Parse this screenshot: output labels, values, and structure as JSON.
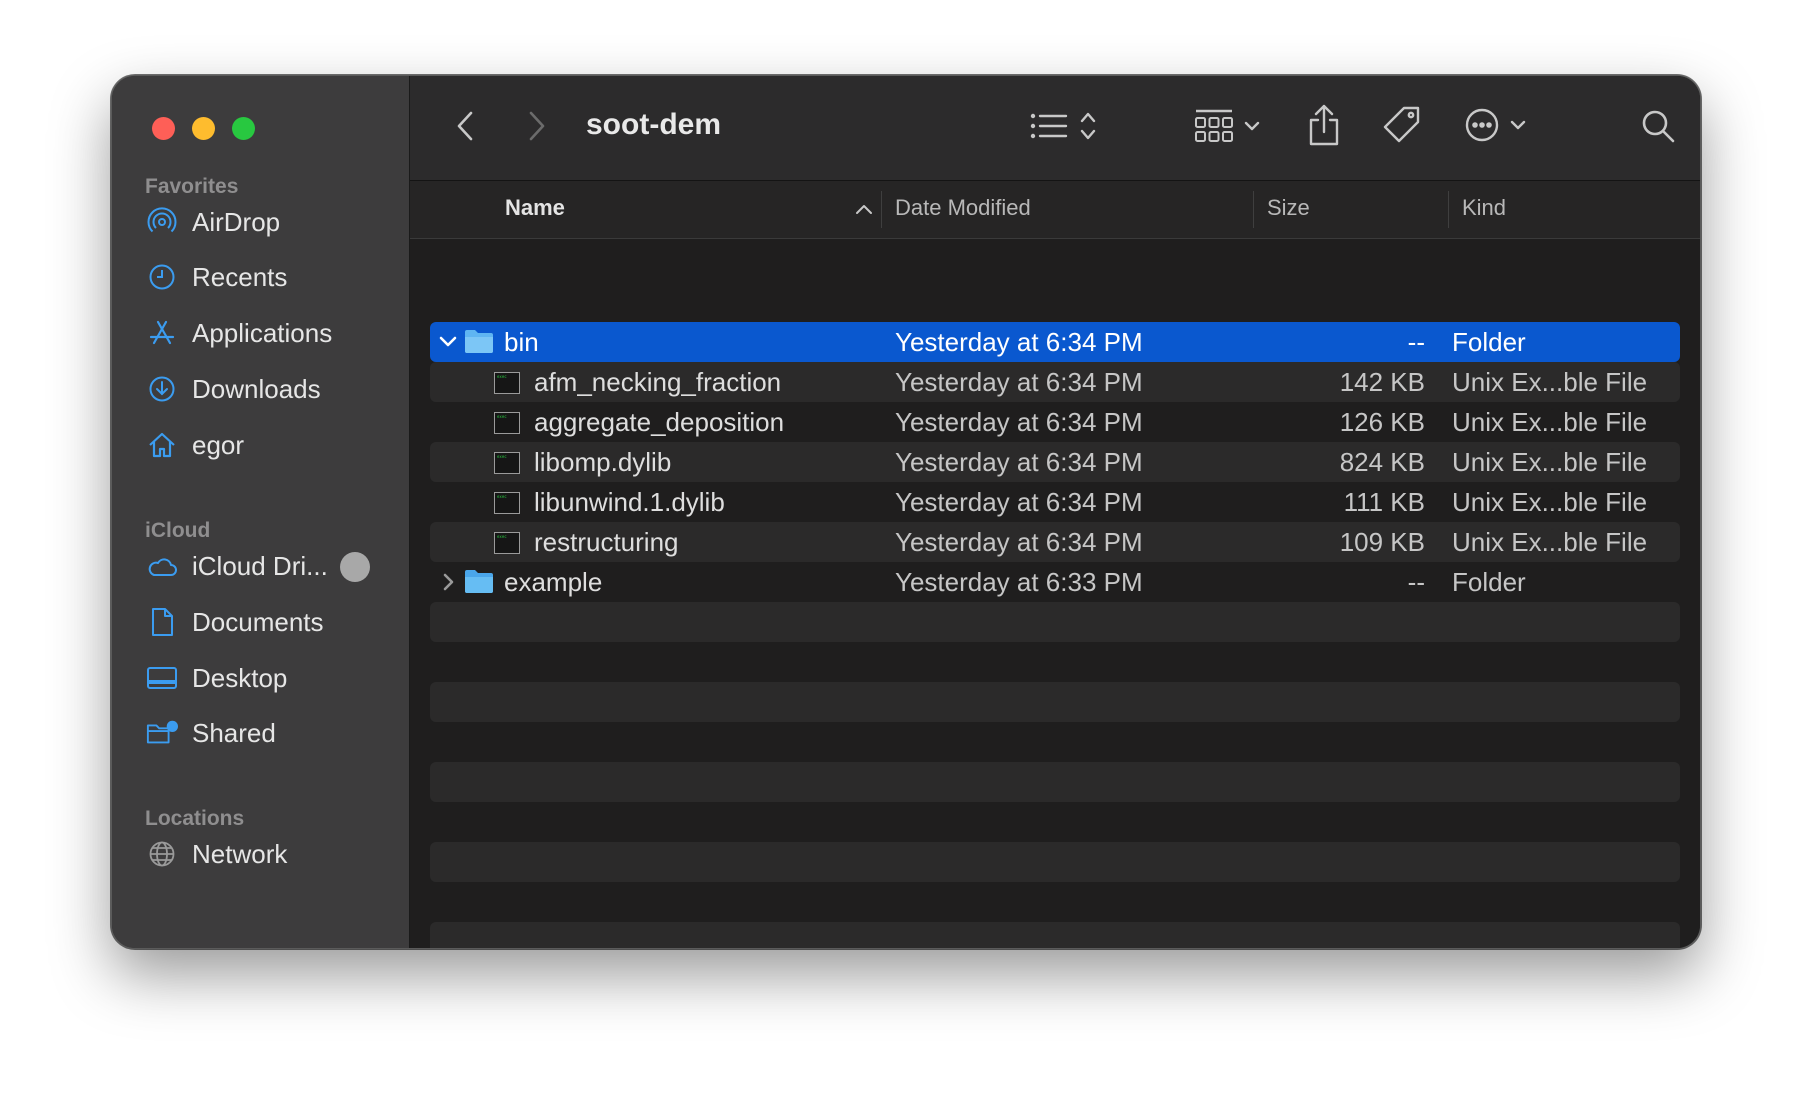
{
  "window": {
    "title": "soot-dem"
  },
  "sidebar": {
    "sections": [
      {
        "header": "Favorites",
        "items": [
          {
            "label": "AirDrop",
            "icon": "airdrop-icon"
          },
          {
            "label": "Recents",
            "icon": "clock-icon"
          },
          {
            "label": "Applications",
            "icon": "applications-icon"
          },
          {
            "label": "Downloads",
            "icon": "download-icon"
          },
          {
            "label": "egor",
            "icon": "home-icon"
          }
        ]
      },
      {
        "header": "iCloud",
        "items": [
          {
            "label": "iCloud Dri...",
            "icon": "cloud-icon"
          },
          {
            "label": "Documents",
            "icon": "document-icon"
          },
          {
            "label": "Desktop",
            "icon": "desktop-icon"
          },
          {
            "label": "Shared",
            "icon": "shared-folder-icon"
          }
        ]
      },
      {
        "header": "Locations",
        "items": [
          {
            "label": "Network",
            "icon": "globe-icon"
          }
        ]
      }
    ]
  },
  "toolbar": {
    "back_icon": "chevron-left-icon",
    "forward_icon": "chevron-right-icon",
    "list_view_icon": "list-view-icon",
    "group_icon": "grid-group-icon",
    "share_icon": "share-icon",
    "tag_icon": "tag-icon",
    "more_icon": "ellipsis-circle-icon",
    "search_icon": "search-icon"
  },
  "columns": {
    "name": "Name",
    "date": "Date Modified",
    "size": "Size",
    "kind": "Kind"
  },
  "rows": [
    {
      "name": "bin",
      "date": "Yesterday at 6:34 PM",
      "size": "--",
      "kind": "Folder",
      "type": "folder",
      "expanded": true,
      "selected": true
    },
    {
      "name": "afm_necking_fraction",
      "date": "Yesterday at 6:34 PM",
      "size": "142 KB",
      "kind": "Unix Ex...ble File",
      "type": "exec"
    },
    {
      "name": "aggregate_deposition",
      "date": "Yesterday at 6:34 PM",
      "size": "126 KB",
      "kind": "Unix Ex...ble File",
      "type": "exec"
    },
    {
      "name": "libomp.dylib",
      "date": "Yesterday at 6:34 PM",
      "size": "824 KB",
      "kind": "Unix Ex...ble File",
      "type": "exec"
    },
    {
      "name": "libunwind.1.dylib",
      "date": "Yesterday at 6:34 PM",
      "size": "111 KB",
      "kind": "Unix Ex...ble File",
      "type": "exec"
    },
    {
      "name": "restructuring",
      "date": "Yesterday at 6:34 PM",
      "size": "109 KB",
      "kind": "Unix Ex...ble File",
      "type": "exec"
    },
    {
      "name": "example",
      "date": "Yesterday at 6:33 PM",
      "size": "--",
      "kind": "Folder",
      "type": "folder",
      "expanded": false
    }
  ],
  "colors": {
    "selection": "#0a58cf",
    "folder": "#5fb5f2",
    "sidebar_icon": "#3b9cf0"
  }
}
